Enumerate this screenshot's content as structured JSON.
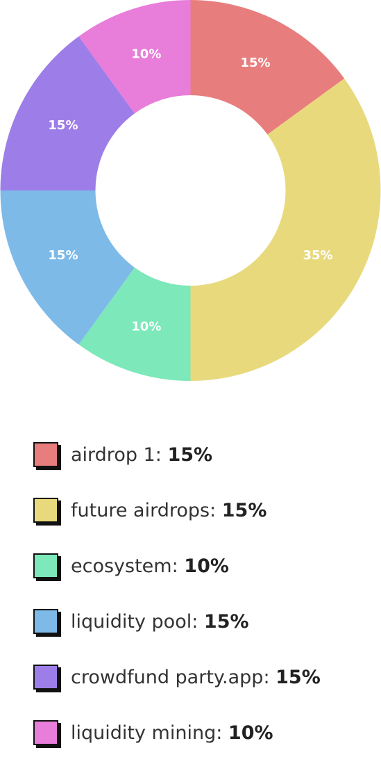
{
  "chart_data": {
    "type": "pie",
    "style": "donut",
    "start_angle_deg": 0,
    "direction": "clockwise",
    "slices": [
      {
        "category": "airdrop 1",
        "value": 15,
        "label": "15%",
        "color": "#E87D7D"
      },
      {
        "category": "future airdrops",
        "value": 35,
        "label": "35%",
        "color": "#E8D97D"
      },
      {
        "category": "ecosystem",
        "value": 10,
        "label": "10%",
        "color": "#7DE8BA"
      },
      {
        "category": "liquidity pool",
        "value": 15,
        "label": "15%",
        "color": "#7DBAE8"
      },
      {
        "category": "crowdfund party.app",
        "value": 15,
        "label": "15%",
        "color": "#9D7DE8"
      },
      {
        "category": "liquidity mining",
        "value": 10,
        "label": "10%",
        "color": "#E87DDA"
      }
    ]
  },
  "legend": {
    "items": [
      {
        "name": "airdrop 1:",
        "value": "15%",
        "color": "#E87D7D"
      },
      {
        "name": "future airdrops:",
        "value": "15%",
        "color": "#E8D97D"
      },
      {
        "name": "ecosystem:",
        "value": "10%",
        "color": "#7DE8BA"
      },
      {
        "name": "liquidity pool:",
        "value": "15%",
        "color": "#7DBAE8"
      },
      {
        "name": "crowdfund party.app:",
        "value": "15%",
        "color": "#9D7DE8"
      },
      {
        "name": "liquidity mining:",
        "value": "10%",
        "color": "#E87DDA"
      }
    ]
  }
}
